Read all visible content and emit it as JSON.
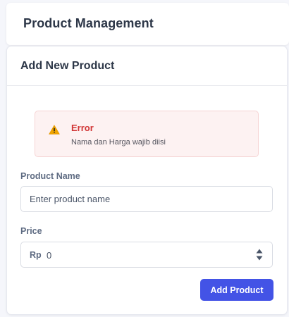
{
  "header": {
    "title": "Product Management"
  },
  "form_card": {
    "title": "Add New Product"
  },
  "alert": {
    "icon": "warning-icon",
    "title": "Error",
    "message": "Nama dan Harga wajib diisi",
    "colors": {
      "background": "#fdf2f2",
      "title": "#d13636",
      "icon": "#f0a400"
    }
  },
  "fields": {
    "name": {
      "label": "Product Name",
      "placeholder": "Enter product name",
      "value": ""
    },
    "price": {
      "label": "Price",
      "prefix": "Rp",
      "value": "0",
      "control_icon": "stepper-icon"
    }
  },
  "actions": {
    "submit_label": "Add Product",
    "submit_color": "#4353e6"
  }
}
